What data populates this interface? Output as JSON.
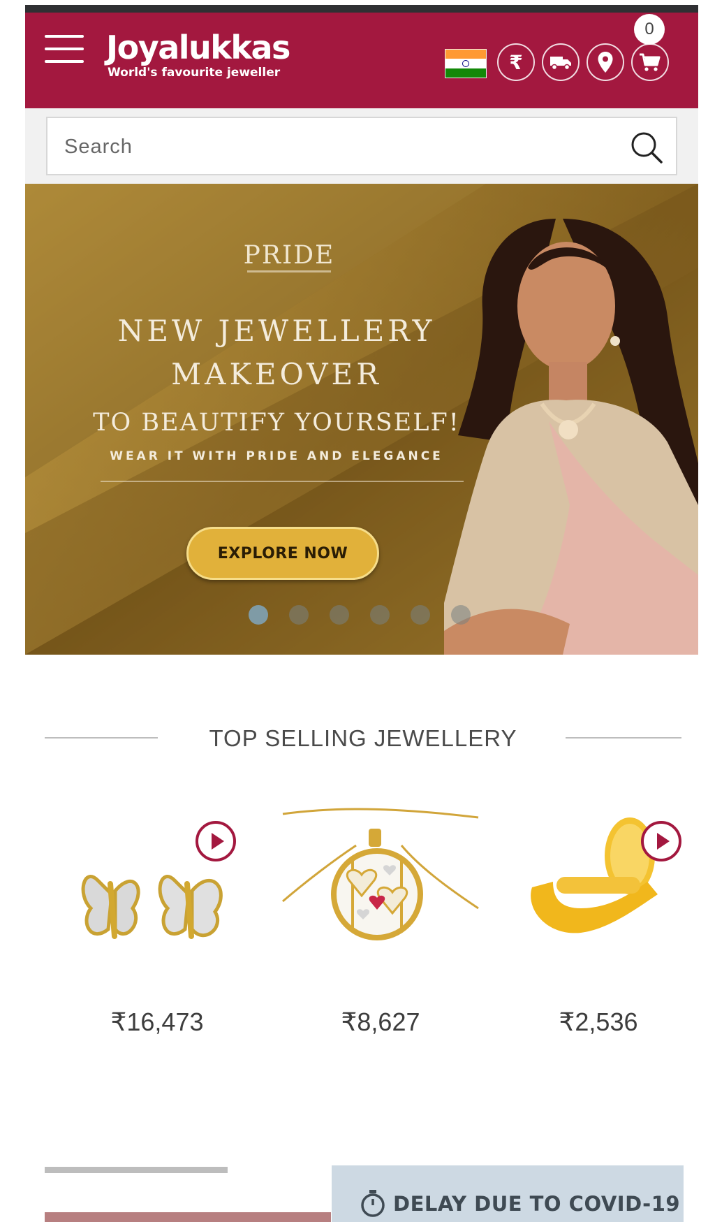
{
  "header": {
    "brand_name": "Joyalukkas",
    "brand_tagline": "World's favourite jeweller",
    "currency_symbol": "₹",
    "cart_count": "0",
    "colors": {
      "brand": "#a3183f",
      "status_strip": "#2f3033"
    },
    "icons": [
      "menu-icon",
      "india-flag-icon",
      "rupee-icon",
      "delivery-truck-icon",
      "location-pin-icon",
      "cart-icon"
    ]
  },
  "search": {
    "placeholder": "Search",
    "value": ""
  },
  "banner": {
    "brand": "PRIDE",
    "headline_1": "NEW JEWELLERY",
    "headline_2": "MAKEOVER",
    "headline_3": "TO BEAUTIFY YOURSELF!",
    "subline": "WEAR IT WITH PRIDE AND ELEGANCE",
    "cta_label": "EXPLORE NOW",
    "slide_count": 6,
    "active_slide": 1
  },
  "top_selling": {
    "title": "TOP SELLING JEWELLERY",
    "products": [
      {
        "price": "₹16,473",
        "icon": "butterfly-earrings-image",
        "has_video": true
      },
      {
        "price": "₹8,627",
        "icon": "heart-pendant-necklace-image",
        "has_video": false
      },
      {
        "price": "₹2,536",
        "icon": "gold-nose-pin-image",
        "has_video": true
      }
    ]
  },
  "notice": {
    "text": "DELAY DUE TO COVID-19",
    "icon": "stopwatch-icon"
  }
}
